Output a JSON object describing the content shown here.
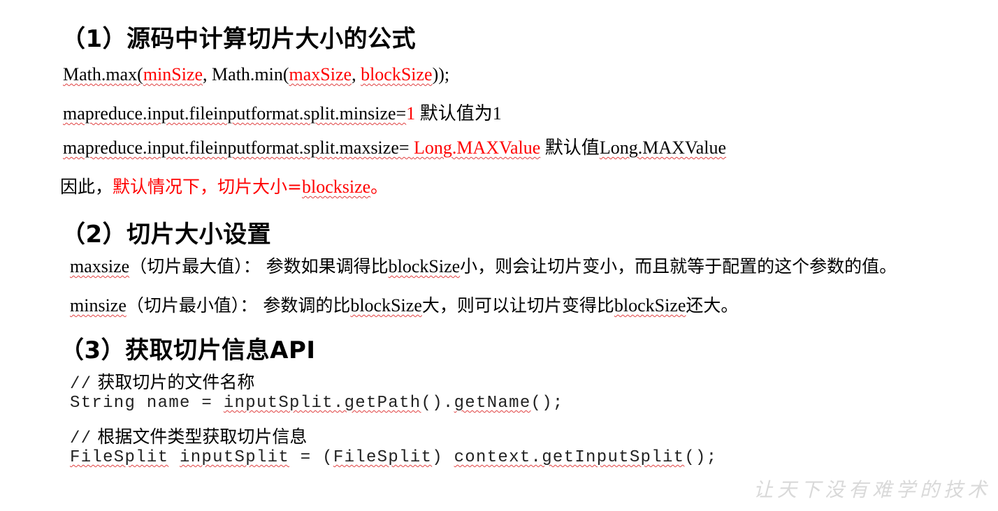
{
  "section1": {
    "heading": "（1）源码中计算切片大小的公式",
    "formula": {
      "p1": "Math.max(",
      "a": "minSize",
      "p2": ", Math.min(",
      "b": "maxSize",
      "p3": ", ",
      "c": "blockSize",
      "p4": "));"
    },
    "minsize_line": {
      "key": "mapreduce.input.fileinputformat.split.minsize=",
      "value": "1",
      "note": " 默认值为1"
    },
    "maxsize_line": {
      "key": "mapreduce.input.fileinputformat.split.maxsize= ",
      "value": "Long.MAXValue",
      "note_cn": " 默认值",
      "note_val": "Long.MAXValue"
    },
    "conclusion": {
      "prefix": "因此，",
      "text": "默认情况下，切片大小=",
      "value": "blocksize",
      "end": "。"
    }
  },
  "section2": {
    "heading": "（2）切片大小设置",
    "maxsize": {
      "term": "maxsize",
      "desc1": "（切片最大值）：  参数如果调得比",
      "term2": "blockSize",
      "desc2": "小，则会让切片变小，而且就等于配置的这个参数的值。"
    },
    "minsize": {
      "term": "minsize",
      "desc1": "（切片最小值）：  参数调的比",
      "term2": "blockSize",
      "desc2": "大，则可以让切片变得比",
      "term3": "blockSize",
      "desc3": "还大。"
    }
  },
  "section3": {
    "heading": "（3）获取切片信息API",
    "comment1_slash": "//",
    "comment1_text": " 获取切片的文件名称",
    "code1": {
      "a": "String name = ",
      "b": "inputSplit.getPath",
      "c": "().",
      "d": "getName",
      "e": "();"
    },
    "comment2_slash": "//",
    "comment2_text": " 根据文件类型获取切片信息",
    "code2": {
      "a": "FileSplit",
      "b": " ",
      "c": "inputSplit",
      "d": " = (",
      "e": "FileSplit",
      "f": ") ",
      "g": "context.getInputSplit",
      "h": "();"
    }
  },
  "watermark": "让天下没有难学的技术"
}
